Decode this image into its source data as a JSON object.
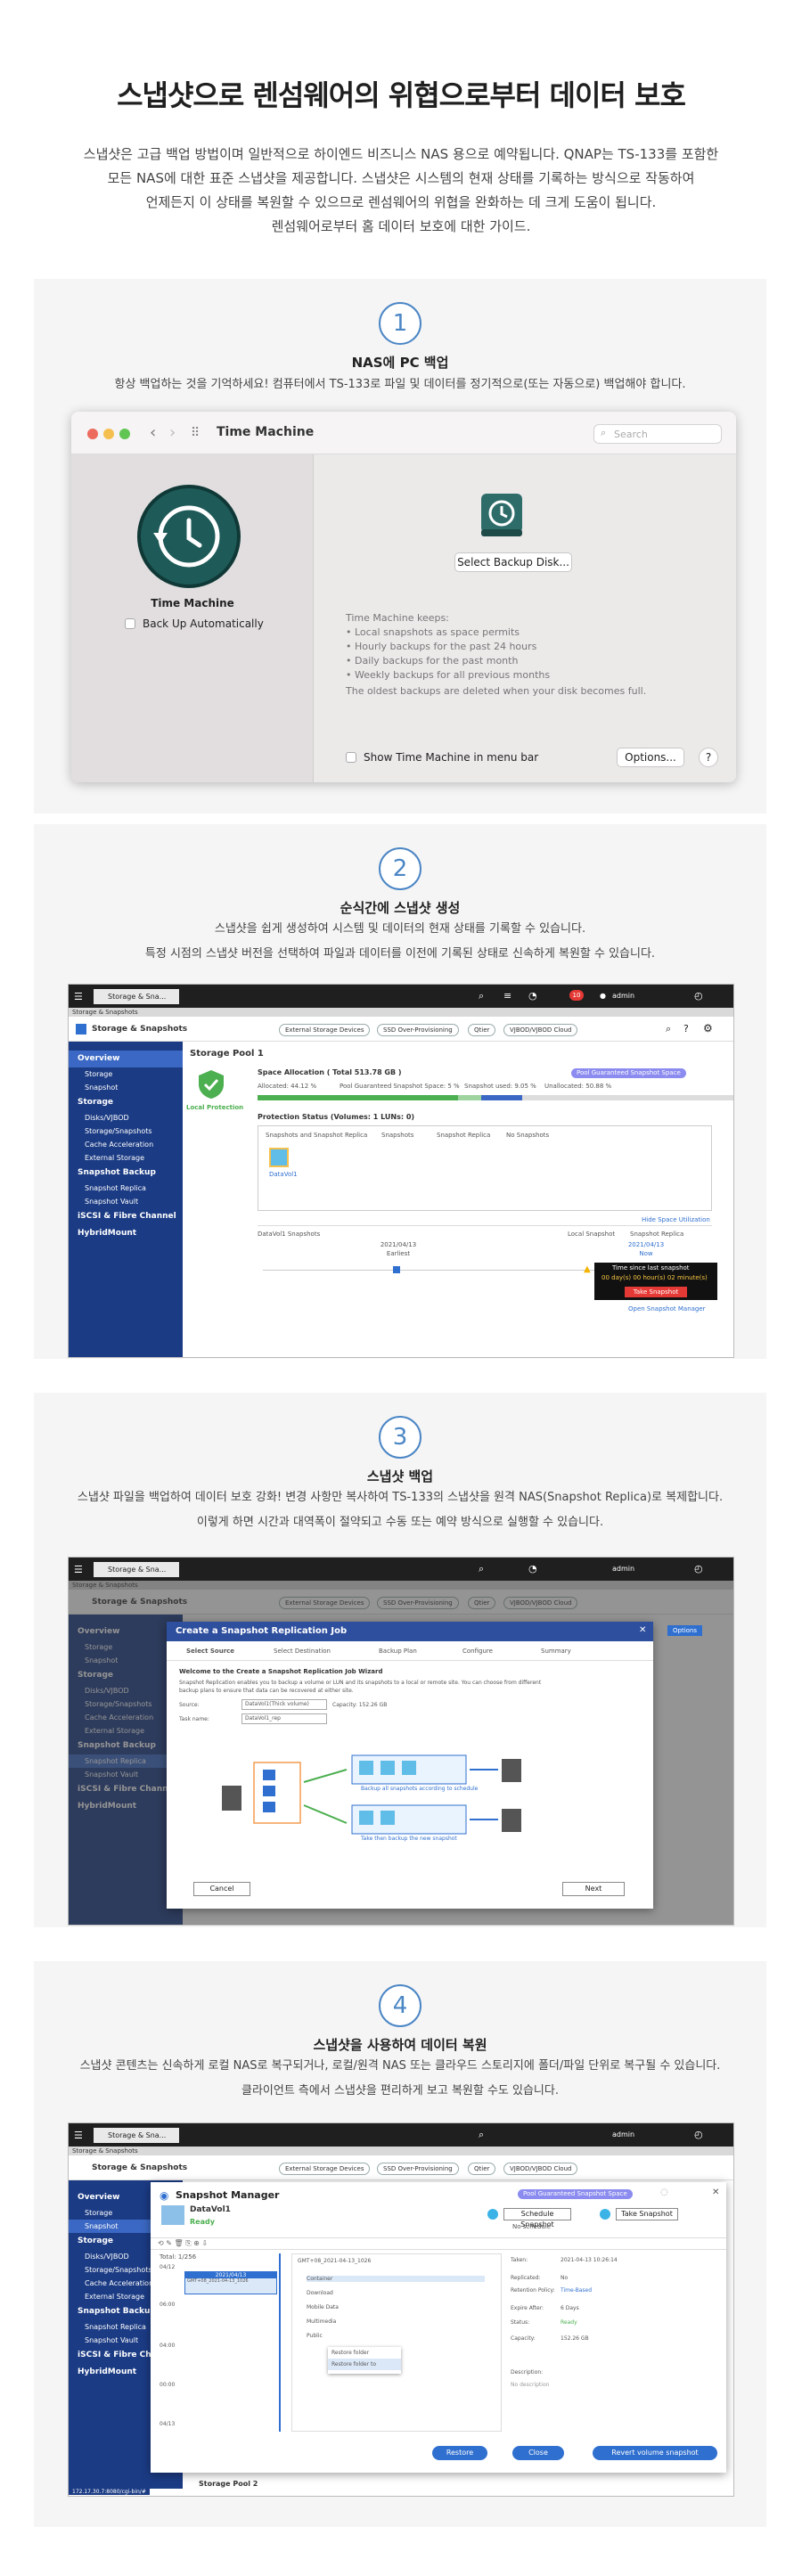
{
  "header": {
    "title": "스냅샷으로 렌섬웨어의 위협으로부터 데이터 보호",
    "intro_lines": [
      "스냅샷은 고급 백업 방법이며 일반적으로 하이엔드 비즈니스 NAS 용으로 예약됩니다. QNAP는 TS-133를 포함한",
      "모든 NAS에 대한 표준 스냅샷을 제공합니다. 스냅샷은 시스템의 현재 상태를 기록하는 방식으로 작동하여",
      "언제든지 이 상태를 복원할 수 있으므로 렌섬웨어의 위협을 완화하는 데 크게 도움이 됩니다.",
      "렌섬웨어로부터 홈 데이터 보호에 대한 가이드."
    ]
  },
  "steps": [
    {
      "number": "1",
      "title": "NAS에 PC 백업",
      "desc": [
        "항상 백업하는 것을 기억하세요! 컴퓨터에서 TS-133로 파일 및 데이터를 정기적으로(또는 자동으로) 백업해야 합니다."
      ]
    },
    {
      "number": "2",
      "title": "순식간에 스냅샷 생성",
      "desc": [
        "스냅샷을 쉽게 생성하여 시스템 및 데이터의 현재 상태를 기록할 수 있습니다.",
        "특정 시점의 스냅샷 버전을 선택하여 파일과 데이터를 이전에 기록된 상태로 신속하게 복원할 수 있습니다."
      ]
    },
    {
      "number": "3",
      "title": "스냅샷 백업",
      "desc": [
        "스냅샷 파일을 백업하여 데이터 보호 강화! 변경 사항만 복사하여 TS-133의 스냅샷을 원격 NAS(Snapshot Replica)로 복제합니다.",
        "이렇게 하면 시간과 대역폭이 절약되고 수동 또는 예약 방식으로 실행할 수 있습니다."
      ]
    },
    {
      "number": "4",
      "title": "스냅샷을 사용하여 데이터 복원",
      "desc": [
        "스냅샷 콘텐츠는 신속하게 로컬 NAS로 복구되거나, 로컬/원격 NAS 또는 클라우드 스토리지에 폴더/파일 단위로 복구될 수 있습니다.",
        "클라이언트 측에서 스냅샷을 편리하게 보고 복원할 수도 있습니다."
      ]
    }
  ],
  "time_machine": {
    "window_title": "Time Machine",
    "search_placeholder": "Search",
    "app_label": "Time Machine",
    "backup_auto": "Back Up Automatically",
    "select_disk": "Select Backup Disk...",
    "keeps_heading": "Time Machine keeps:",
    "keeps": [
      "• Local snapshots as space permits",
      "• Hourly backups for the past 24 hours",
      "• Daily backups for the past month",
      "• Weekly backups for all previous months"
    ],
    "note": "The oldest backups are deleted when your disk becomes full.",
    "show_menu": "Show Time Machine in menu bar",
    "options": "Options...",
    "help": "?"
  },
  "qnap": {
    "tab_label": "Storage & Sna...",
    "app_title": "Storage & Snapshots",
    "admin": "admin",
    "notify_count": "10",
    "pills": [
      "External Storage Devices",
      "SSD Over-Provisioning",
      "Qtier",
      "VJBOD/VJBOD Cloud"
    ],
    "sidebar": [
      "Overview",
      "Storage",
      "Snapshot",
      "Storage",
      "Disks/VJBOD",
      "Storage/Snapshots",
      "Cache Acceleration",
      "External Storage",
      "Snapshot Backup",
      "Snapshot Replica",
      "Snapshot Vault",
      "iSCSI & Fibre Channel",
      "HybridMount"
    ],
    "pool_title": "Storage Pool 1",
    "local_protection": "Local Protection",
    "space_title": "Space Allocation ( Total 513.78 GB )",
    "pool_badge": "Pool Guaranteed Snapshot Space",
    "space_legend": [
      "Allocated: 44.12 %",
      "Pool Guaranteed Snapshot Space: 5 %",
      "Snapshot used: 9.05 %",
      "Unallocated: 50.88 %"
    ],
    "space_fractions": [
      0.4412,
      0.05,
      0.0905,
      0.5088
    ],
    "protection_title": "Protection Status (Volumes: 1 LUNs: 0)",
    "protection_filters": [
      "Snapshots and Snapshot Replica",
      "Snapshots",
      "Snapshot Replica",
      "No Snapshots"
    ],
    "vol_label": "DataVol1",
    "hide_util": "Hide Space Utilization",
    "timeline_title": "DataVol1 Snapshots",
    "local_snapshot": "Local Snapshot",
    "snapshot_replica": "Snapshot Replica",
    "earliest_date": "2021/04/13",
    "earliest_label": "Earliest",
    "now_date": "2021/04/13",
    "now_label": "Now",
    "time_since": "Time since last snapshot",
    "counter": "00",
    "counter_text": "00 day(s) 00 hour(s) 02 minute(s)",
    "take_snapshot": "Take Snapshot",
    "open_manager": "Open Snapshot Manager"
  },
  "replication": {
    "dialog_title": "Create a Snapshot Replication Job",
    "steps": [
      "Select Source",
      "Select Destination",
      "Backup Plan",
      "Configure",
      "Summary"
    ],
    "welcome": "Welcome to the Create a Snapshot Replication Job Wizard",
    "body": "Snapshot Replication enables you to backup a volume or LUN and its snapshots to a local or remote site. You can choose from different backup plans to ensure that data can be recovered at either site.",
    "source_label": "Source:",
    "source_value": "DataVol1(Thick volume)",
    "capacity": "Capacity: 152.26 GB",
    "task_label": "Task name:",
    "task_value": "DataVol1_rep",
    "caption1": "Backup all snapshots according to schedule",
    "caption2": "Take then backup the new snapshot",
    "cancel": "Cancel",
    "next": "Next",
    "options_tab": "Options"
  },
  "manager": {
    "title": "Snapshot Manager",
    "badge": "Pool Guaranteed Snapshot Space",
    "vol": "DataVol1",
    "status": "Ready",
    "schedule": "Schedule Snapshot",
    "no_schedule": "No schedule",
    "take": "Take Snapshot",
    "total": "Total: 1/256",
    "date_head": "2021/04/13",
    "snap_name": "GMT+08_2021-04-13_1026",
    "tree_root": "GMT+08_2021-04-13_1026",
    "folders": [
      "Container",
      "Download",
      "Mobile Data",
      "Multimedia",
      "Public"
    ],
    "context": [
      "Restore folder",
      "Restore folder to"
    ],
    "times": [
      "04/12",
      "06:00",
      "04:00",
      "00:00",
      "04/13"
    ],
    "details_labels": [
      "Taken:",
      "Replicated:",
      "Retention Policy:",
      "Expire After:",
      "Status:",
      "Capacity:",
      "Description:"
    ],
    "details_values": [
      "2021-04-13 10:26:14",
      "No",
      "Time-Based",
      "6 Days",
      "Ready",
      "152.26 GB",
      "No description"
    ],
    "restore": "Restore",
    "close": "Close",
    "revert": "Revert volume snapshot",
    "pool2": "Storage Pool 2",
    "url": "172.17.30.7:8080/cgi-bin/#"
  },
  "colors": {
    "accent": "#4b86c5",
    "qnap_nav": "#1b3b84",
    "qnap_blue": "#2f6fcf",
    "green": "#4caf50"
  }
}
